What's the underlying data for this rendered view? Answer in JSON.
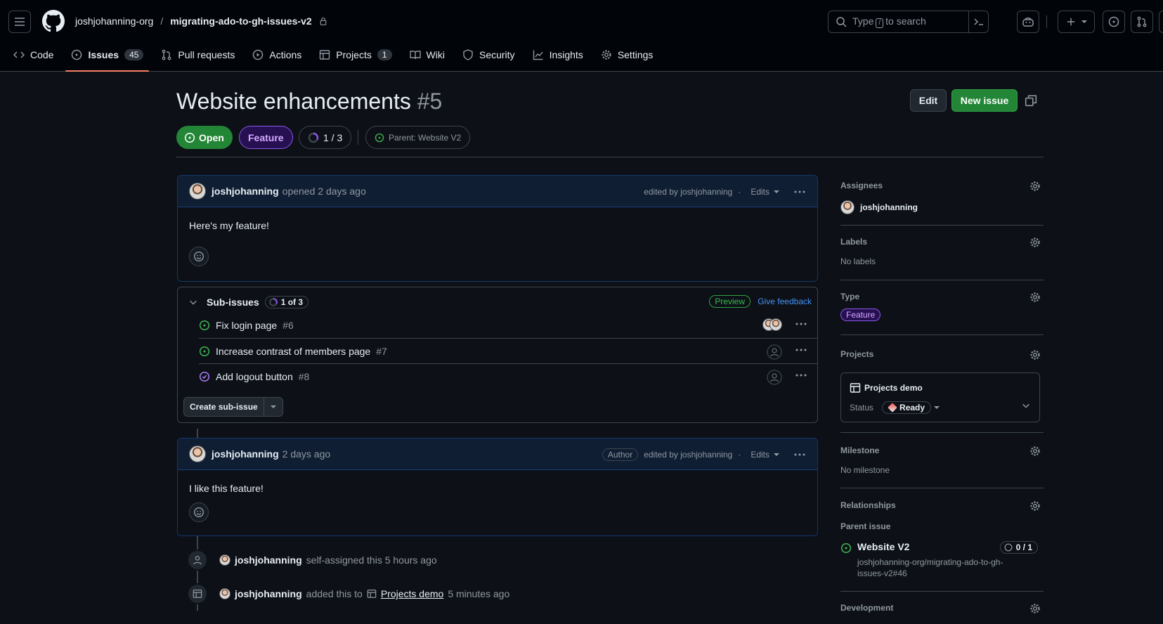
{
  "header": {
    "owner": "joshjohanning-org",
    "separator": "/",
    "repo": "migrating-ado-to-gh-issues-v2",
    "search_prefix": "Type",
    "search_key": "/",
    "search_suffix": "to search"
  },
  "repo_tabs": [
    {
      "label": "Code",
      "icon": "code-icon"
    },
    {
      "label": "Issues",
      "icon": "issue-icon",
      "count": "45",
      "active": true
    },
    {
      "label": "Pull requests",
      "icon": "pull-request-icon"
    },
    {
      "label": "Actions",
      "icon": "play-icon"
    },
    {
      "label": "Projects",
      "icon": "table-icon",
      "count": "1"
    },
    {
      "label": "Wiki",
      "icon": "book-icon"
    },
    {
      "label": "Security",
      "icon": "shield-icon"
    },
    {
      "label": "Insights",
      "icon": "graph-icon"
    },
    {
      "label": "Settings",
      "icon": "gear-icon"
    }
  ],
  "issue": {
    "title": "Website enhancements",
    "number": "#5",
    "edit_label": "Edit",
    "new_issue_label": "New issue",
    "state": "Open",
    "type": "Feature",
    "progress": "1 / 3",
    "progress_fraction": 0.33,
    "parent": "Parent: Website V2"
  },
  "first_comment": {
    "author": "joshjohanning",
    "action": "opened 2 days ago",
    "edited": "edited by joshjohanning",
    "dot": "·",
    "edits_label": "Edits",
    "body": "Here's my feature!"
  },
  "sub_issues": {
    "title": "Sub-issues",
    "progress": "1 of 3",
    "preview": "Preview",
    "feedback": "Give feedback",
    "items": [
      {
        "title": "Fix login page",
        "num": "#6",
        "state": "open"
      },
      {
        "title": "Increase contrast of members page",
        "num": "#7",
        "state": "open"
      },
      {
        "title": "Add logout button",
        "num": "#8",
        "state": "closed"
      }
    ],
    "create_label": "Create sub-issue"
  },
  "second_comment": {
    "author": "joshjohanning",
    "time": "2 days ago",
    "badge": "Author",
    "edited": "edited by joshjohanning",
    "dot": "·",
    "edits_label": "Edits",
    "body": "I like this feature!"
  },
  "timeline": [
    {
      "user": "joshjohanning",
      "text": "self-assigned this 5 hours ago"
    },
    {
      "user": "joshjohanning",
      "text_before": "added this to",
      "project": "Projects demo",
      "text_after": "5 minutes ago"
    }
  ],
  "sidebar": {
    "assignees_label": "Assignees",
    "assignee": "joshjohanning",
    "labels_label": "Labels",
    "labels_value": "No labels",
    "type_label": "Type",
    "type_value": "Feature",
    "projects_label": "Projects",
    "project_name": "Projects demo",
    "status_label": "Status",
    "status_value": "Ready",
    "milestone_label": "Milestone",
    "milestone_value": "No milestone",
    "relationships_label": "Relationships",
    "parent_issue_label": "Parent issue",
    "parent_title": "Website V2",
    "parent_progress": "0 / 1",
    "parent_ref_line1": "joshjohanning-org/migrating-ado-to-gh-",
    "parent_ref_line2": "issues-v2#46",
    "development_label": "Development"
  },
  "colors": {
    "bg": "#0d1117",
    "open_green": "#238636",
    "closed_purple": "#8957e5",
    "accent_blue": "#4493f8"
  }
}
